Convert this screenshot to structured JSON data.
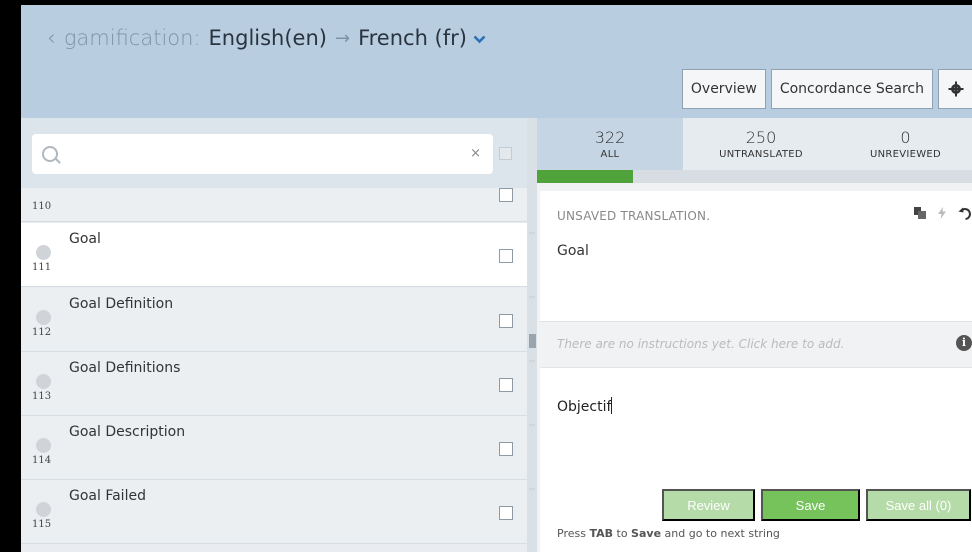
{
  "header": {
    "back": "‹",
    "project": "gamification:",
    "source_lang": "English(en)",
    "arrow": "→",
    "target_lang": "French (fr)",
    "caret": "⌄"
  },
  "toolbar": {
    "overview_label": "Overview",
    "concordance_label": "Concordance Search",
    "settings_icon": "gear-icon"
  },
  "search": {
    "placeholder": "",
    "clear": "×"
  },
  "strings": [
    {
      "label": "",
      "num": "110"
    },
    {
      "label": "Goal",
      "num": "111",
      "active": true
    },
    {
      "label": "Goal Definition",
      "num": "112"
    },
    {
      "label": "Goal Definitions",
      "num": "113"
    },
    {
      "label": "Goal Description",
      "num": "114"
    },
    {
      "label": "Goal Failed",
      "num": "115"
    }
  ],
  "stats": {
    "all": {
      "count": "322",
      "label": "ALL"
    },
    "untranslated": {
      "count": "250",
      "label": "UNTRANSLATED"
    },
    "unreviewed": {
      "count": "0",
      "label": "UNREVIEWED"
    }
  },
  "progress": {
    "fraction": 0.22,
    "color": "#4fa33a"
  },
  "editor": {
    "status": "UNSAVED TRANSLATION.",
    "source_text": "Goal",
    "instructions": "There are no instructions yet. Click here to add.",
    "translation": "Objectif",
    "review_label": "Review",
    "save_label": "Save",
    "save_all_label": "Save all (0)",
    "hint_press": "Press",
    "hint_tab": "TAB",
    "hint_to": "to",
    "hint_save": "Save",
    "hint_rest": "and go to next string"
  }
}
